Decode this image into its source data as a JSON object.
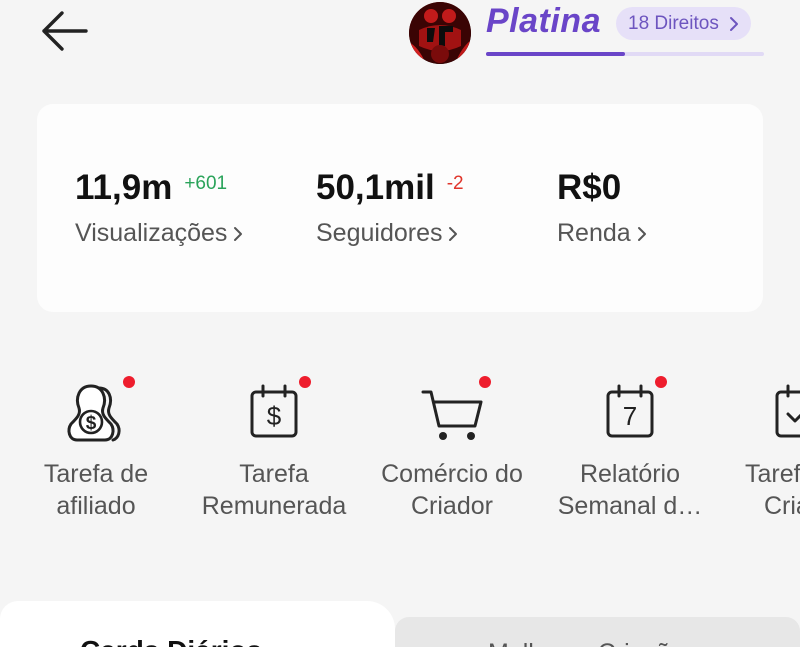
{
  "header": {
    "back_icon": "arrow-left-icon",
    "tier_name": "Platina",
    "rights_label": "18 Direitos",
    "progress_fraction": 0.5,
    "accent_color": "#6a45c8"
  },
  "stats": [
    {
      "value": "11,9m",
      "delta": "+601",
      "delta_type": "positive",
      "label": "Visualizações"
    },
    {
      "value": "50,1mil",
      "delta": "-2",
      "delta_type": "negative",
      "label": "Seguidores"
    },
    {
      "value": "R$0",
      "delta": "",
      "delta_type": "none",
      "label": "Renda"
    }
  ],
  "tools": [
    {
      "icon": "affiliate-task-icon",
      "label_line1": "Tarefa de",
      "label_line2": "afiliado",
      "has_dot": true
    },
    {
      "icon": "paid-task-calendar-icon",
      "label_line1": "Tarefa",
      "label_line2": "Remunerada",
      "has_dot": true
    },
    {
      "icon": "cart-icon",
      "label_line1": "Comércio do",
      "label_line2": "Criador",
      "has_dot": true
    },
    {
      "icon": "weekly-report-calendar-icon",
      "label_line1": "Relatório",
      "label_line2": "Semanal d…",
      "has_dot": true
    },
    {
      "icon": "task-calendar-icon",
      "label_line1": "Taref",
      "label_line2": "Cria",
      "has_dot": false
    }
  ],
  "calendar_day": "7",
  "tabs": [
    {
      "label": "Cards Diários",
      "active": true
    },
    {
      "label": "Melhores Criações",
      "active": false
    }
  ],
  "colors": {
    "notification_dot": "#ee1d2d",
    "positive": "#2aa35a",
    "negative": "#e0352b"
  }
}
